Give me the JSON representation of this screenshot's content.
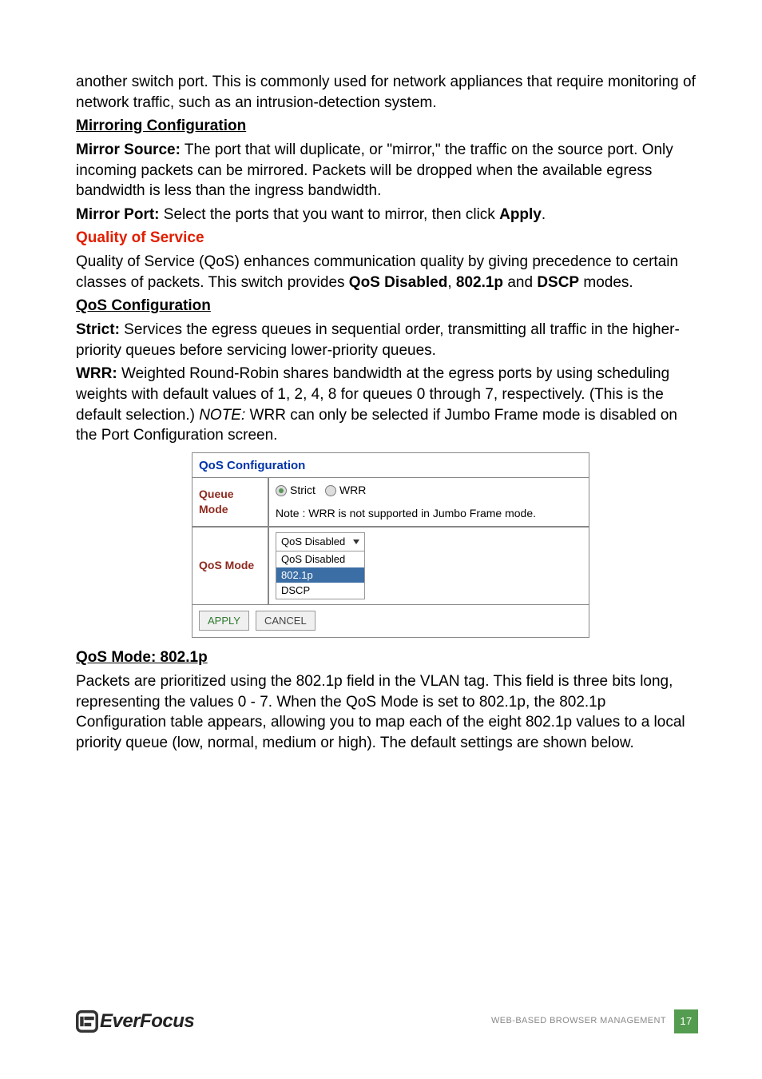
{
  "p1": "another switch port. This is commonly used for network appliances that require monitoring of network traffic, such as an intrusion-detection system.",
  "h_mirroring": "Mirroring Configuration",
  "mirror_source_label": "Mirror Source:",
  "mirror_source_text": " The port that will duplicate, or \"mirror,\" the traffic on the source port. Only incoming packets can be mirrored. Packets will be dropped when the available egress bandwidth is less than the ingress bandwidth.",
  "mirror_port_label": "Mirror Port:",
  "mirror_port_text_a": " Select the ports that you want to mirror, then click ",
  "mirror_port_text_b": "Apply",
  "mirror_port_text_c": ".",
  "h_qos_service": "Quality of Service",
  "qos_intro_a": "Quality of Service (QoS) enhances communication quality by giving precedence to certain classes of packets. This switch provides ",
  "qos_intro_b": "QoS Disabled",
  "qos_intro_c": ", ",
  "qos_intro_d": "802.1p",
  "qos_intro_e": " and ",
  "qos_intro_f": "DSCP",
  "qos_intro_g": " modes.",
  "h_qos_config": "QoS Configuration",
  "strict_label": "Strict:",
  "strict_text": " Services the egress queues in sequential order, transmitting all traffic in the higher-priority queues before servicing lower-priority queues.",
  "wrr_label": "WRR:",
  "wrr_text_a": " Weighted Round-Robin shares bandwidth at the egress ports by using scheduling weights with default values of 1, 2, 4, 8 for queues 0 through 7, respectively. (This is the default selection.) ",
  "wrr_note_label": "NOTE:",
  "wrr_text_b": " WRR can only be selected if Jumbo Frame mode is disabled on the Port Configuration screen.",
  "ui": {
    "title": "QoS Configuration",
    "queue_mode_label": "Queue Mode",
    "strict": "Strict",
    "wrr": "WRR",
    "note": "Note : WRR is not supported in Jumbo Frame mode.",
    "qos_mode_label": "QoS Mode",
    "selected": "QoS Disabled",
    "options": [
      "QoS Disabled",
      "802.1p",
      "DSCP"
    ],
    "apply": "APPLY",
    "cancel": "CANCEL"
  },
  "h_8021p": "QoS Mode: 802.1p",
  "p_8021p": "Packets are prioritized using the 802.1p field in the VLAN tag. This field is three bits long, representing the values 0 - 7. When the QoS Mode is set to 802.1p, the 802.1p Configuration table appears, allowing you to map each of the eight 802.1p values to a local priority queue (low, normal, medium or high). The default settings are shown below.",
  "footer": {
    "brand": "EverFocus",
    "section": "WEB-BASED BROWSER MANAGEMENT",
    "page": "17"
  }
}
